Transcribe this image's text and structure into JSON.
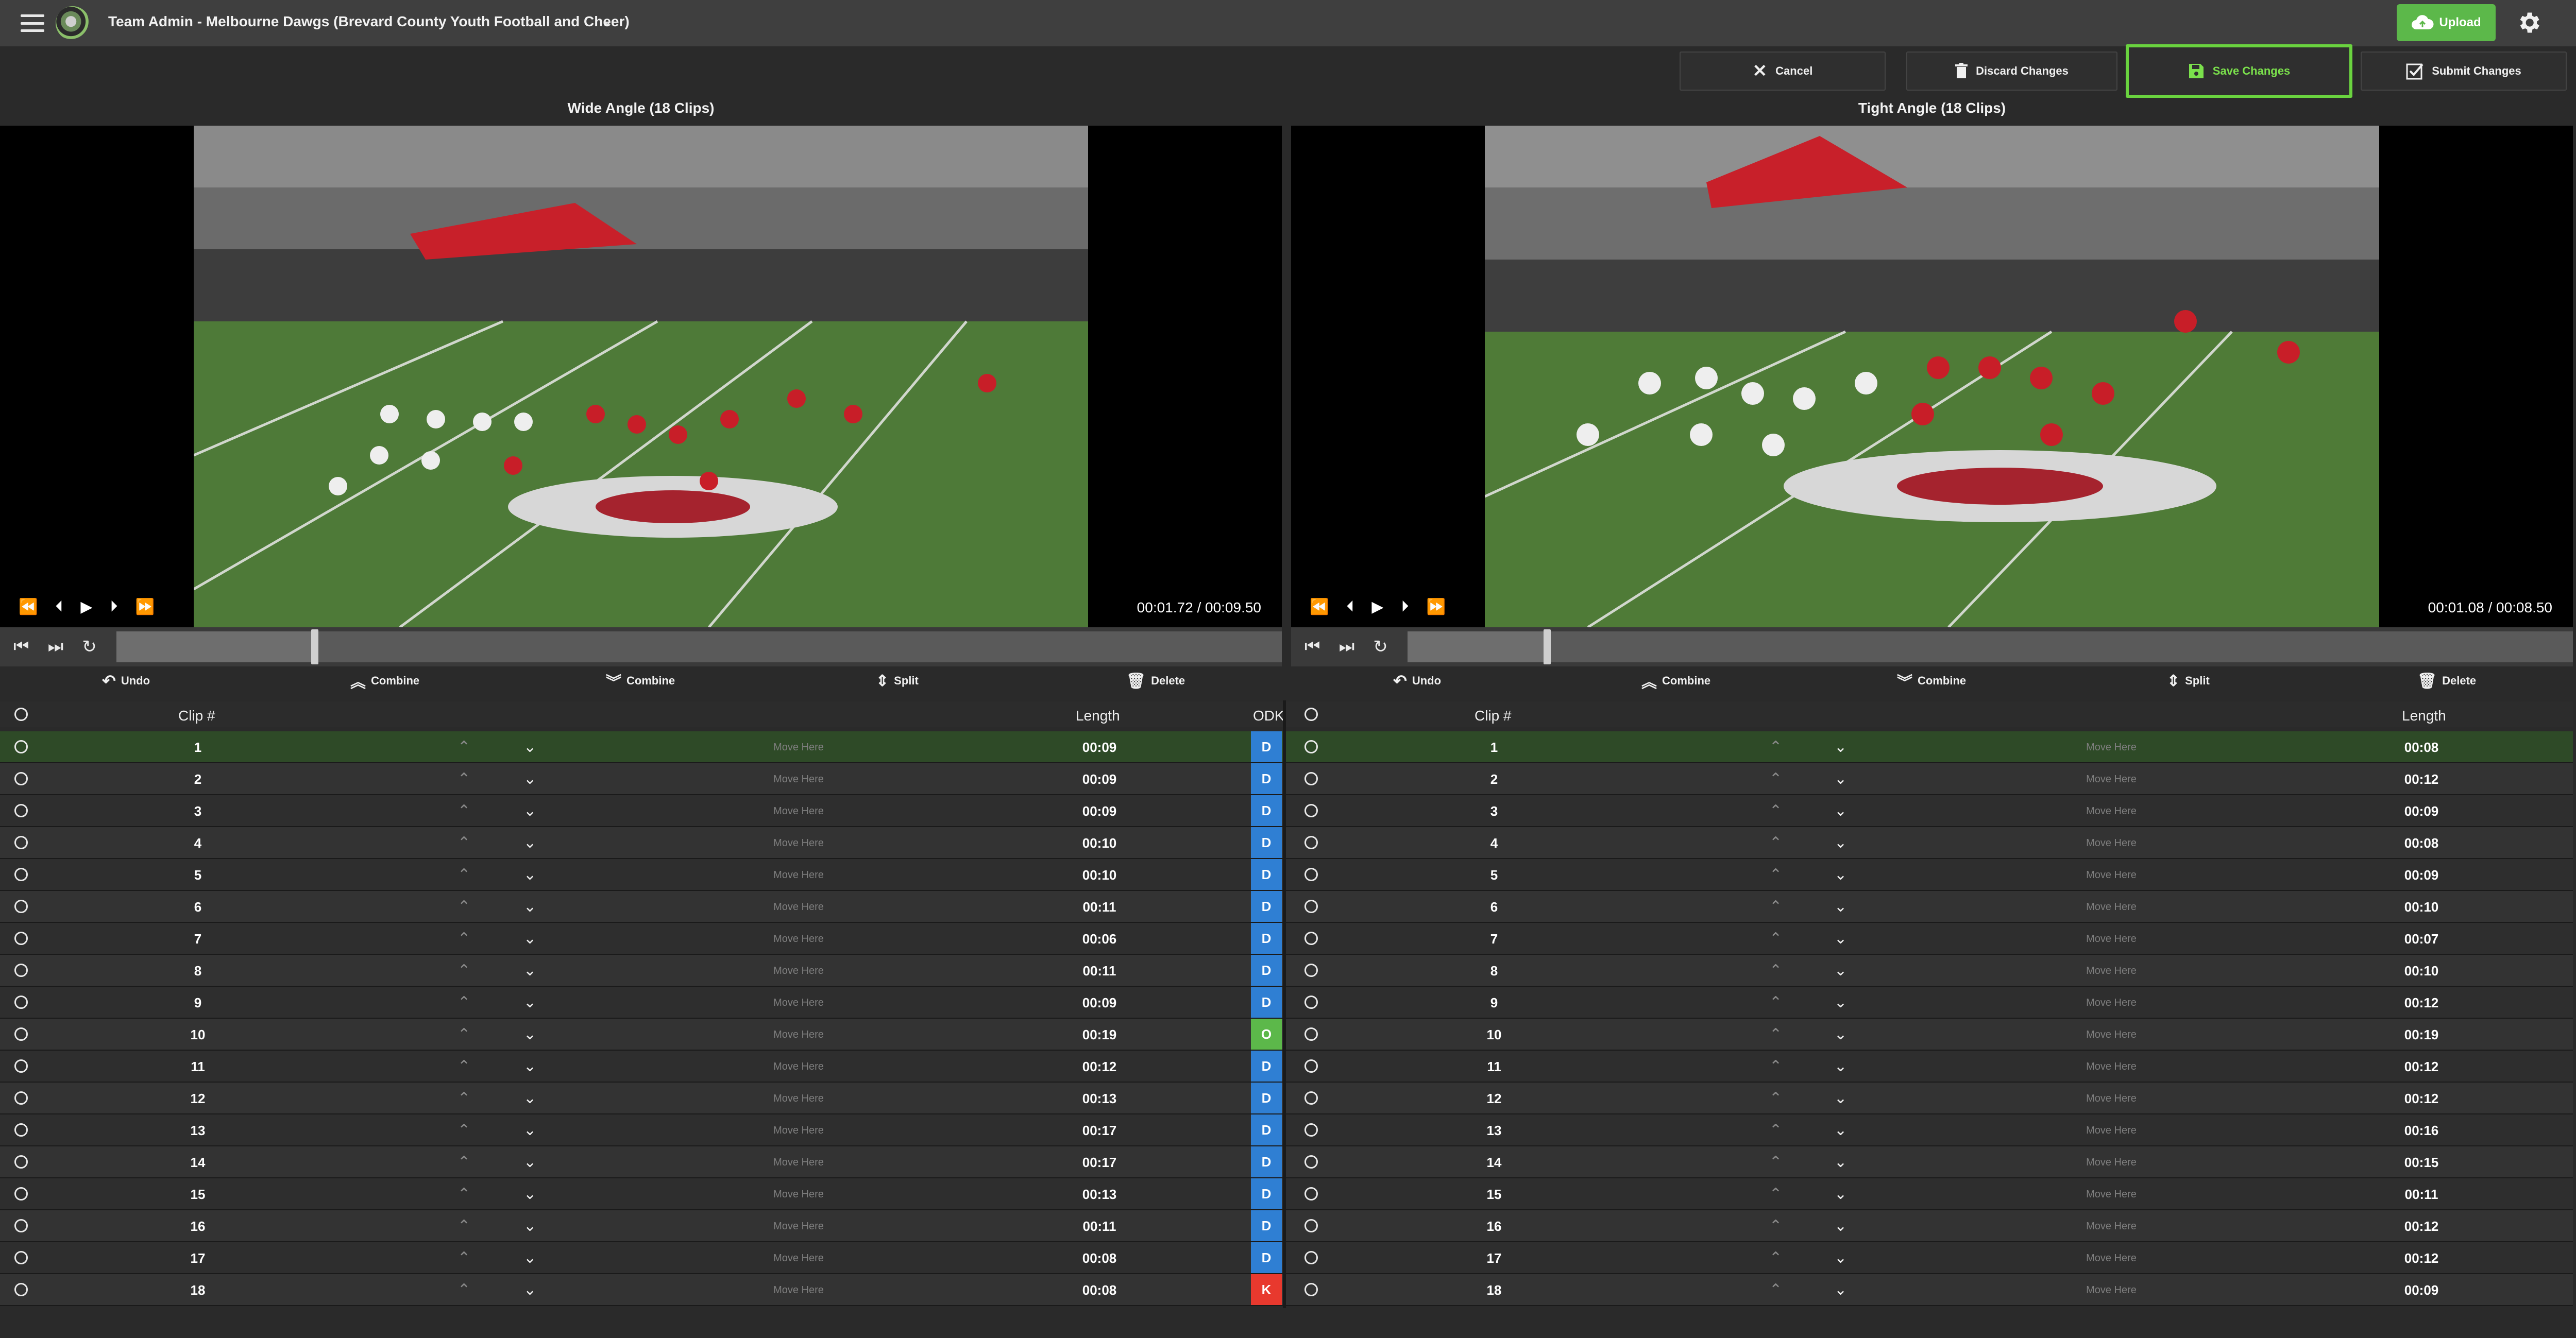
{
  "header": {
    "title": "Team Admin - Melbourne Dawgs (Brevard County Youth Football and Cheer)",
    "upload_label": "Upload"
  },
  "actions": {
    "cancel": "Cancel",
    "discard": "Discard Changes",
    "save": "Save Changes",
    "submit": "Submit Changes"
  },
  "left": {
    "title": "Wide Angle (18 Clips)",
    "timecode": "00:01.72 / 00:09.50",
    "progress": 0.17
  },
  "right": {
    "title": "Tight Angle (18 Clips)",
    "timecode": "00:01.08 / 00:08.50",
    "progress": 0.12
  },
  "tools": {
    "undo": "Undo",
    "combine_up": "Combine",
    "combine_down": "Combine",
    "split": "Split",
    "delete": "Delete"
  },
  "columns": {
    "clip": "Clip #",
    "length": "Length",
    "odk": "ODK",
    "move_here": "Move Here"
  },
  "odk_colors": {
    "D": "#2f7fd3",
    "O": "#5cb84a",
    "K": "#e8392e"
  },
  "left_rows": [
    {
      "clip": "1",
      "length": "00:09",
      "odk": "D"
    },
    {
      "clip": "2",
      "length": "00:09",
      "odk": "D"
    },
    {
      "clip": "3",
      "length": "00:09",
      "odk": "D"
    },
    {
      "clip": "4",
      "length": "00:10",
      "odk": "D"
    },
    {
      "clip": "5",
      "length": "00:10",
      "odk": "D"
    },
    {
      "clip": "6",
      "length": "00:11",
      "odk": "D"
    },
    {
      "clip": "7",
      "length": "00:06",
      "odk": "D"
    },
    {
      "clip": "8",
      "length": "00:11",
      "odk": "D"
    },
    {
      "clip": "9",
      "length": "00:09",
      "odk": "D"
    },
    {
      "clip": "10",
      "length": "00:19",
      "odk": "O"
    },
    {
      "clip": "11",
      "length": "00:12",
      "odk": "D"
    },
    {
      "clip": "12",
      "length": "00:13",
      "odk": "D"
    },
    {
      "clip": "13",
      "length": "00:17",
      "odk": "D"
    },
    {
      "clip": "14",
      "length": "00:17",
      "odk": "D"
    },
    {
      "clip": "15",
      "length": "00:13",
      "odk": "D"
    },
    {
      "clip": "16",
      "length": "00:11",
      "odk": "D"
    },
    {
      "clip": "17",
      "length": "00:08",
      "odk": "D"
    },
    {
      "clip": "18",
      "length": "00:08",
      "odk": "K"
    }
  ],
  "right_rows": [
    {
      "clip": "1",
      "length": "00:08"
    },
    {
      "clip": "2",
      "length": "00:12"
    },
    {
      "clip": "3",
      "length": "00:09"
    },
    {
      "clip": "4",
      "length": "00:08"
    },
    {
      "clip": "5",
      "length": "00:09"
    },
    {
      "clip": "6",
      "length": "00:10"
    },
    {
      "clip": "7",
      "length": "00:07"
    },
    {
      "clip": "8",
      "length": "00:10"
    },
    {
      "clip": "9",
      "length": "00:12"
    },
    {
      "clip": "10",
      "length": "00:19"
    },
    {
      "clip": "11",
      "length": "00:12"
    },
    {
      "clip": "12",
      "length": "00:12"
    },
    {
      "clip": "13",
      "length": "00:16"
    },
    {
      "clip": "14",
      "length": "00:15"
    },
    {
      "clip": "15",
      "length": "00:11"
    },
    {
      "clip": "16",
      "length": "00:12"
    },
    {
      "clip": "17",
      "length": "00:12"
    },
    {
      "clip": "18",
      "length": "00:09"
    }
  ]
}
